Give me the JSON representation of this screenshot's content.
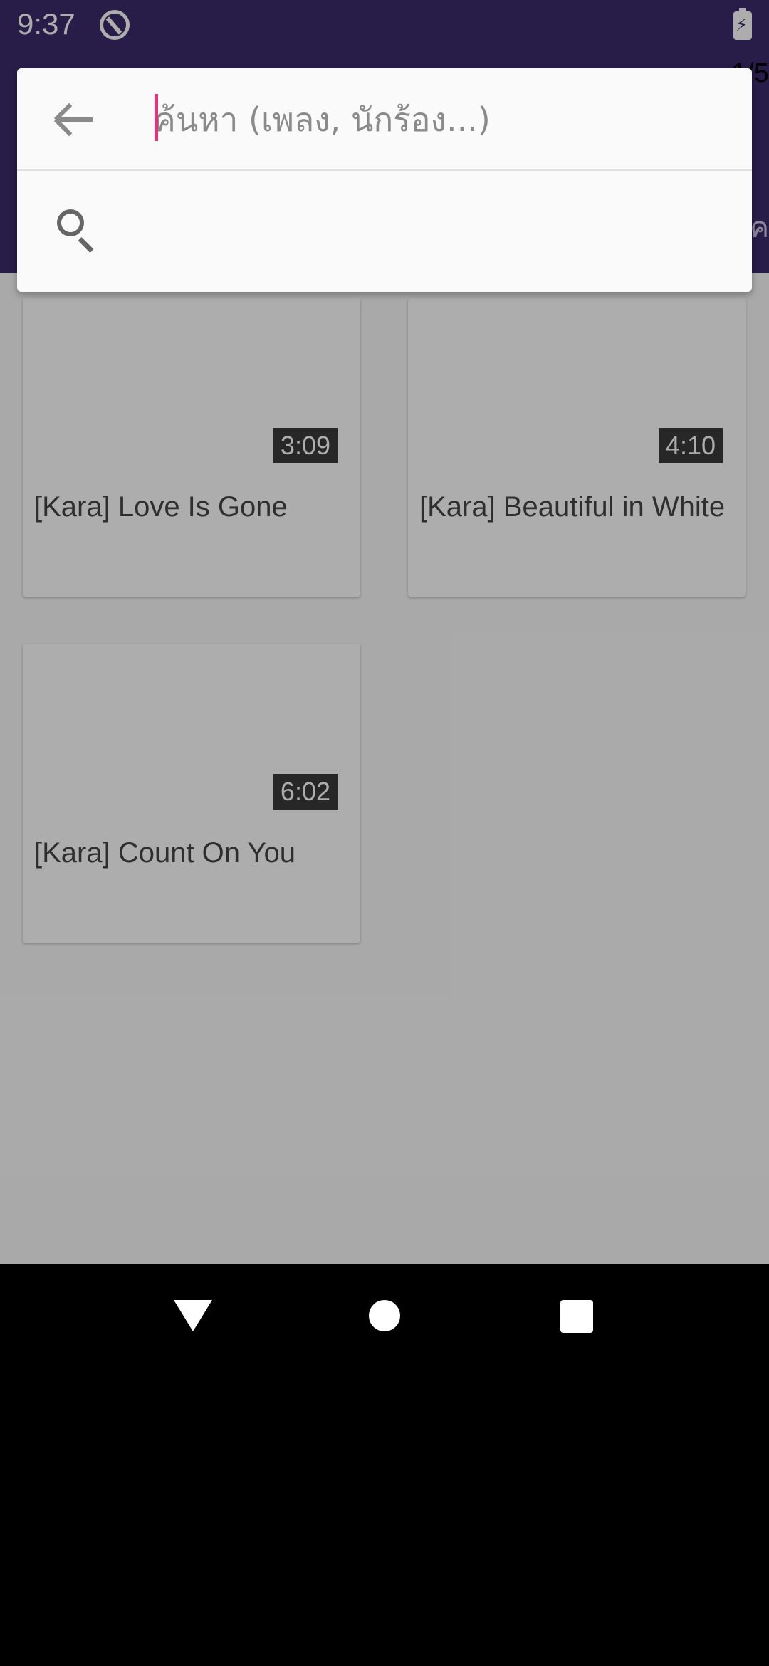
{
  "status_bar": {
    "time": "9:37"
  },
  "app_bar": {
    "page_indicator": "1/5",
    "partial_text": "ค"
  },
  "search": {
    "placeholder": "ค้นหา (เพลง, นักร้อง...)",
    "value": ""
  },
  "songs": [
    {
      "duration": "3:09",
      "title": "[Kara] Love Is Gone"
    },
    {
      "duration": "4:10",
      "title": "[Kara] Beautiful in White"
    },
    {
      "duration": "6:02",
      "title": "[Kara] Count On You"
    }
  ],
  "colors": {
    "primary": "#3a2c6b",
    "fab": "#5a46a8",
    "caret": "#e0357a"
  },
  "icons": {
    "back": "arrow-back-icon",
    "search": "search-icon",
    "fab": "trash-icon",
    "nav": [
      "nav-back-icon",
      "nav-home-icon",
      "nav-recent-icon"
    ]
  }
}
